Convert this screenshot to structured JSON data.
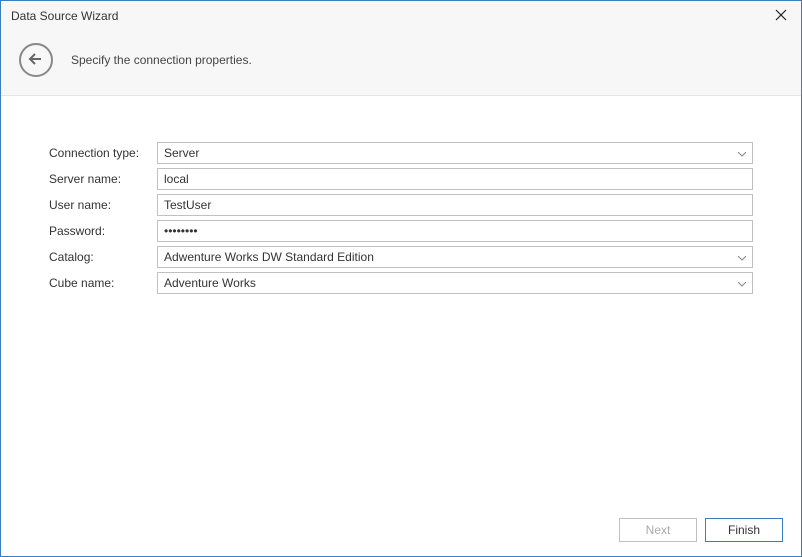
{
  "window": {
    "title": "Data Source Wizard"
  },
  "header": {
    "subtitle": "Specify the connection properties."
  },
  "form": {
    "connection_type": {
      "label": "Connection type:",
      "value": "Server"
    },
    "server_name": {
      "label": "Server name:",
      "value": "local"
    },
    "user_name": {
      "label": "User name:",
      "value": "TestUser"
    },
    "password": {
      "label": "Password:",
      "value": "••••••••"
    },
    "catalog": {
      "label": "Catalog:",
      "value": "Adwenture Works DW Standard Edition"
    },
    "cube_name": {
      "label": "Cube name:",
      "value": "Adventure Works"
    }
  },
  "footer": {
    "next": "Next",
    "finish": "Finish"
  }
}
